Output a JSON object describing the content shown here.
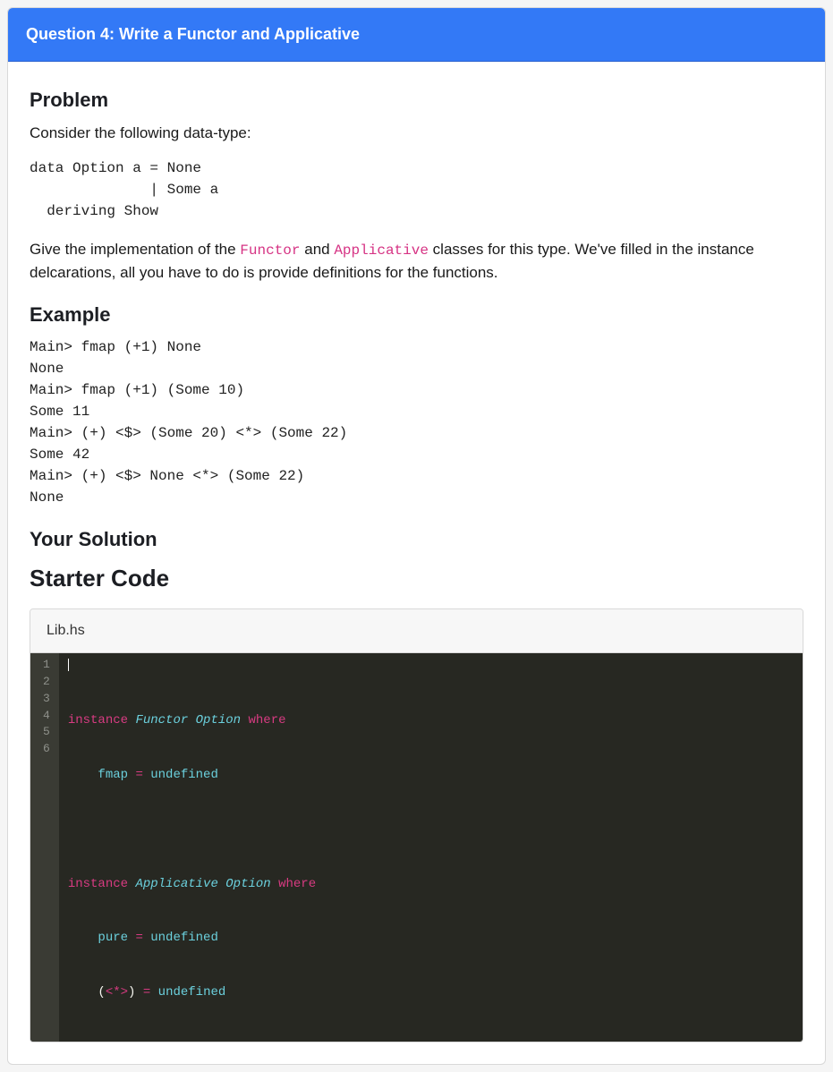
{
  "header": {
    "title": "Question 4: Write a Functor and Applicative"
  },
  "problem": {
    "heading": "Problem",
    "intro": "Consider the following data-type:",
    "datatype": "data Option a = None\n              | Some a\n  deriving Show",
    "task_pre": "Give the implementation of the ",
    "code1": "Functor",
    "task_mid": " and ",
    "code2": "Applicative",
    "task_post": " classes for this type. We've filled in the instance delcarations, all you have to do is provide definitions for the functions."
  },
  "example": {
    "heading": "Example",
    "text": "Main> fmap (+1) None\nNone\nMain> fmap (+1) (Some 10)\nSome 11\nMain> (+) <$> (Some 20) <*> (Some 22)\nSome 42\nMain> (+) <$> None <*> (Some 22)\nNone"
  },
  "solution": {
    "heading": "Your Solution"
  },
  "starter": {
    "heading": "Starter Code",
    "filename": "Lib.hs",
    "line_numbers": [
      "1",
      "2",
      "3",
      "4",
      "5",
      "6"
    ],
    "code": {
      "l1": {
        "kw1": "instance",
        "t1": "Functor",
        "t2": "Option",
        "kw2": "where"
      },
      "l2": {
        "id": "fmap",
        "eq": "=",
        "val": "undefined"
      },
      "l4": {
        "kw1": "instance",
        "t1": "Applicative",
        "t2": "Option",
        "kw2": "where"
      },
      "l5": {
        "id": "pure",
        "eq": "=",
        "val": "undefined"
      },
      "l6": {
        "lp": "(",
        "sym": "<*>",
        "rp": ")",
        "eq": "=",
        "val": "undefined"
      }
    }
  }
}
